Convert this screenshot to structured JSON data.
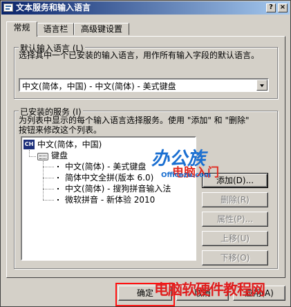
{
  "window": {
    "title": "文本服务和输入语言",
    "minimize_glyph": "?",
    "close_glyph": "×"
  },
  "tabs": [
    {
      "label": "常规",
      "active": true
    },
    {
      "label": "语言栏",
      "active": false
    },
    {
      "label": "高级键设置",
      "active": false
    }
  ],
  "default_lang": {
    "group_label": "默认输入语言 (L)",
    "description": "选择其中一个已安装的输入语言，用作所有输入字段的默认语言。",
    "selected": "中文(简体，中国) - 中文(简体) - 美式键盘"
  },
  "installed": {
    "group_label": "已安装的服务 (I)",
    "description_line1": "为列表中显示的每个输入语言选择服务。使用 \"添加\" 和 \"删除\"",
    "description_line2": "按钮来修改这个列表。",
    "tree": {
      "language_icon": "CH",
      "language": "中文(简体，中国)",
      "category": "键盘",
      "items": [
        "中文(简体) - 美式键盘",
        "简体中文全拼(版本 6.0)",
        "中文(简体) - 搜狗拼音输入法",
        "微软拼音 - 新体验 2010"
      ]
    },
    "buttons": {
      "add": "添加(D)...",
      "remove": "删除(R)",
      "properties": "属性(P)...",
      "move_up": "上移(U)",
      "move_down": "下移(O)"
    }
  },
  "footer": {
    "ok": "确定",
    "cancel": "取消",
    "apply": "应用(A)"
  },
  "watermarks": {
    "logo": "办公族",
    "site": "Officezu.com",
    "pc": "电脑入门",
    "bottom": "电脑软硬件教程网"
  },
  "colors": {
    "titlebar_start": "#0a246a",
    "titlebar_end": "#a6caf0",
    "face": "#d4d0c8",
    "highlight_box": "#ff1010"
  },
  "icons": [
    "app-icon",
    "language-icon",
    "keyboard-icon",
    "dropdown-arrow-icon",
    "minimize-icon",
    "close-icon"
  ]
}
